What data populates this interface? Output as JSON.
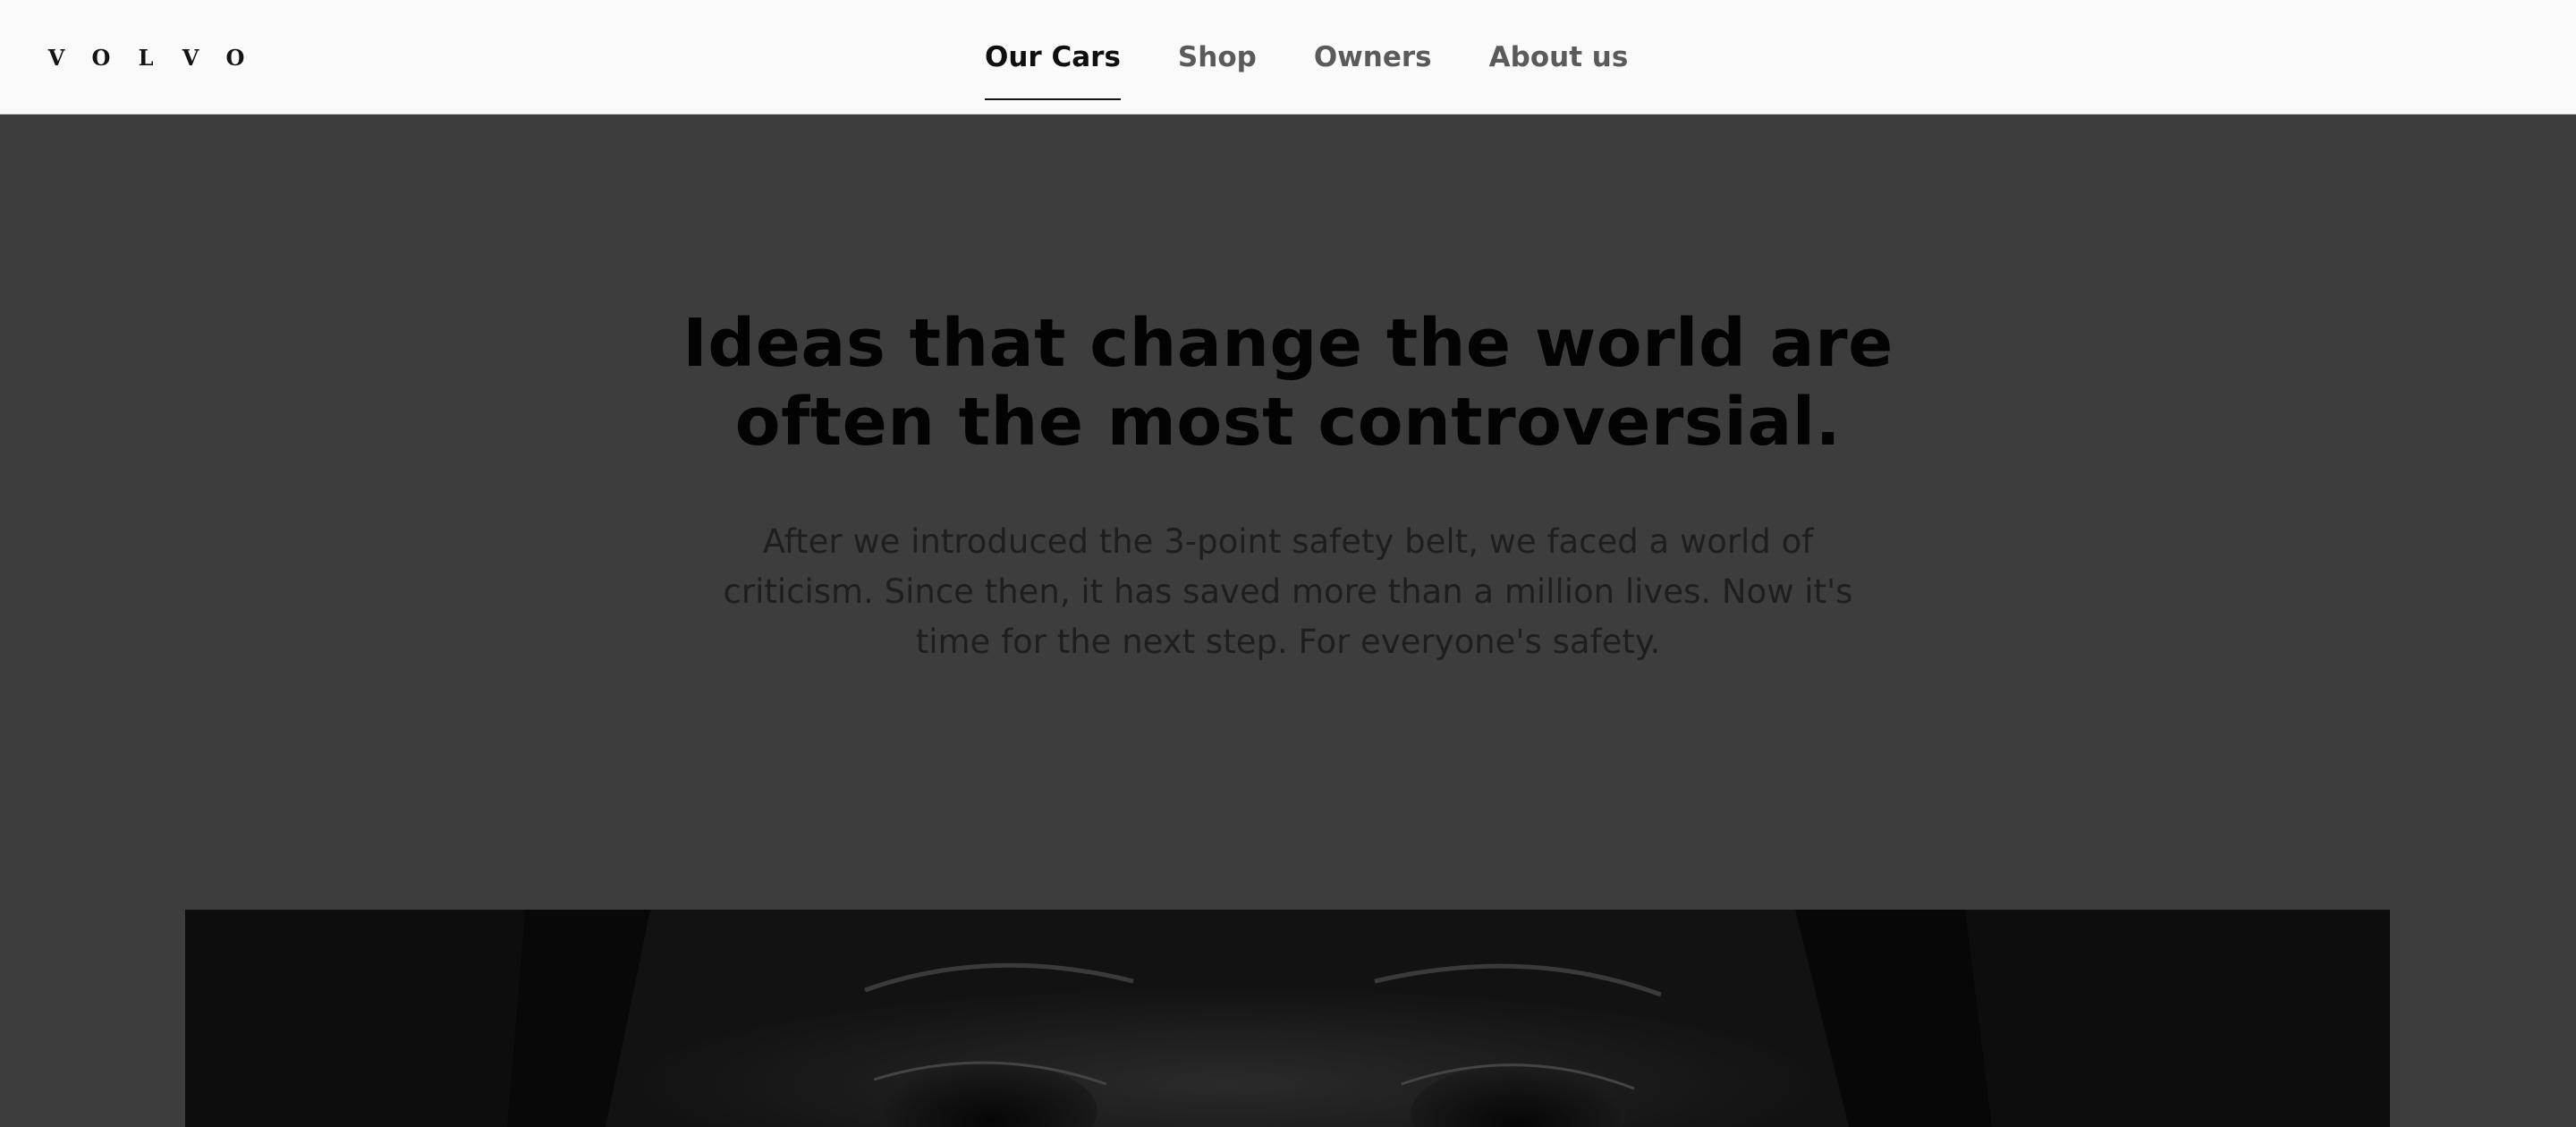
{
  "header": {
    "logo": {
      "letters": [
        "V",
        "O",
        "L",
        "V",
        "O"
      ]
    },
    "nav": [
      {
        "label": "Our Cars",
        "active": true
      },
      {
        "label": "Shop",
        "active": false
      },
      {
        "label": "Owners",
        "active": false
      },
      {
        "label": "About us",
        "active": false
      }
    ]
  },
  "hero": {
    "headline": "Ideas that change the world are often the most controversial.",
    "body": "After we introduced the 3-point safety belt, we faced a world of criticism. Since then, it has saved more than a million lives. Now it's time for the next step. For everyone's safety.",
    "image": {
      "icon": "child-face-photo"
    }
  },
  "colors": {
    "header_bg": "#fafafa",
    "overlay_bg": "#3d3d3d",
    "text_dark": "#030303",
    "nav_inactive": "#5a5a5a"
  }
}
